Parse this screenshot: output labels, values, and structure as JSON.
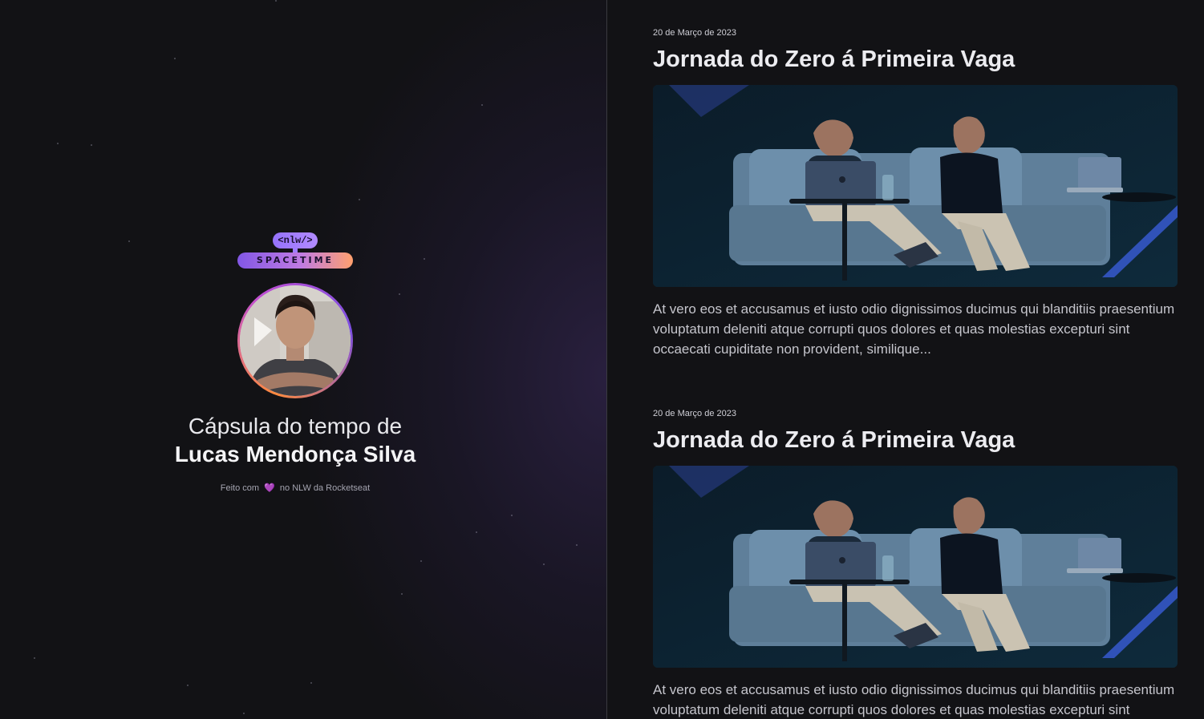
{
  "brand": {
    "tag": "<nlw/>",
    "name": "SPACETIME"
  },
  "profile": {
    "title_prefix": "Cápsula do tempo de",
    "user_name": "Lucas Mendonça Silva"
  },
  "footer": {
    "before": "Feito com",
    "heart": "💜",
    "after": "no NLW da Rocketseat"
  },
  "memories": [
    {
      "date": "20 de Março de 2023",
      "title": "Jornada do Zero á Primeira Vaga",
      "excerpt": "At vero eos et accusamus et iusto odio dignissimos ducimus qui blanditiis praesentium voluptatum deleniti atque corrupti quos dolores et quas molestias excepturi sint occaecati cupiditate non provident, similique..."
    },
    {
      "date": "20 de Março de 2023",
      "title": "Jornada do Zero á Primeira Vaga",
      "excerpt": "At vero eos et accusamus et iusto odio dignissimos ducimus qui blanditiis praesentium voluptatum deleniti atque corrupti quos dolores et quas molestias excepturi sint occaecati cupiditate non provident, similique..."
    }
  ],
  "colors": {
    "background": "#121215",
    "brand_purple": "#8257e5",
    "brand_orange": "#ffa06e"
  }
}
